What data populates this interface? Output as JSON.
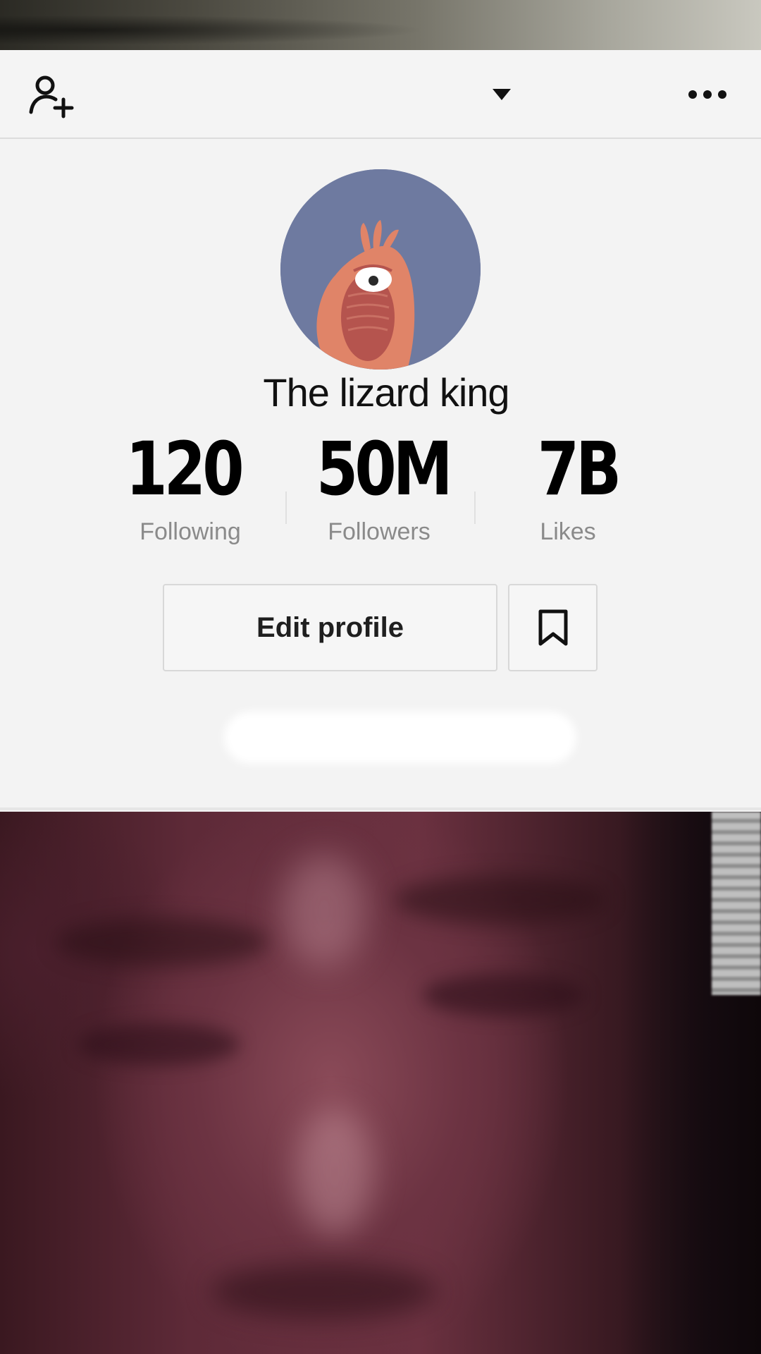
{
  "profile": {
    "username": "The lizard king",
    "stats": {
      "following": {
        "value": "120",
        "label": "Following"
      },
      "followers": {
        "value": "50M",
        "label": "Followers"
      },
      "likes": {
        "value": "7B",
        "label": "Likes"
      }
    },
    "edit_button_label": "Edit profile"
  },
  "icons": {
    "add_user": "add-user-icon",
    "dropdown": "caret-down-icon",
    "more": "more-options-icon",
    "bookmark": "bookmark-icon"
  },
  "colors": {
    "avatar_background": "#6e7aa0",
    "card_background": "#f3f3f3",
    "label_gray": "#8a8a8a"
  }
}
